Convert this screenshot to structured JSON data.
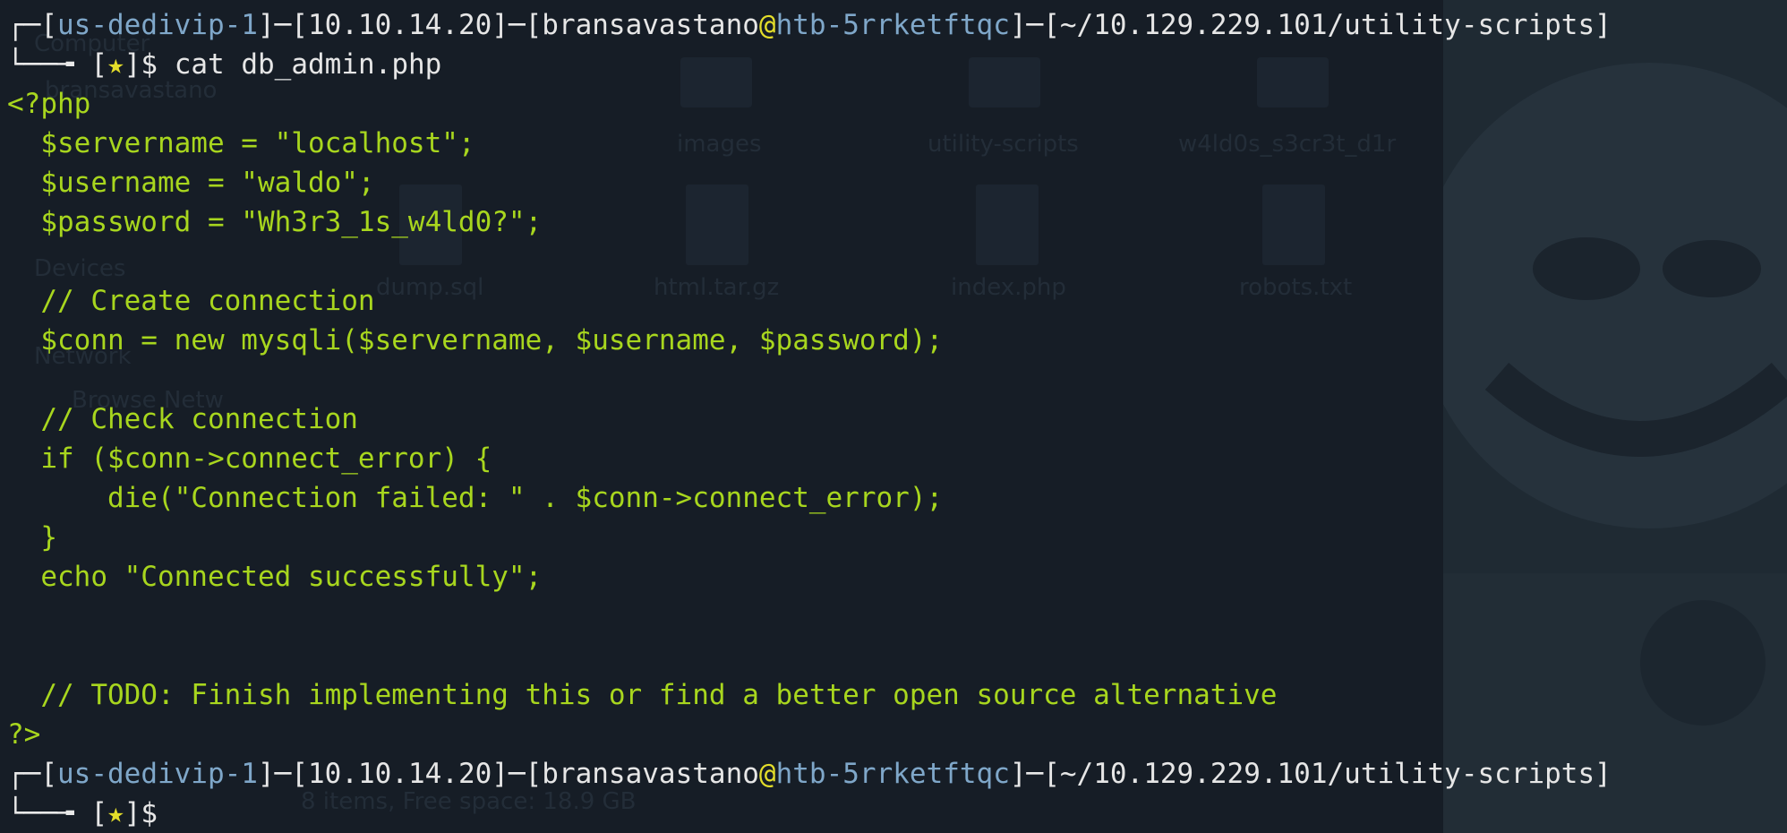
{
  "desktop": {
    "sidebar_items": [
      "Computer",
      "bransavastano",
      "Devices",
      "Network",
      "Browse Netw"
    ],
    "folders": [
      "images",
      "utility-scripts",
      "w4ld0s_s3cr3t_d1r"
    ],
    "files": [
      "dump.sql",
      "html.tar.gz",
      "index.php",
      "robots.txt"
    ],
    "status": "8 items, Free space: 18.9 GB"
  },
  "prompt": {
    "frame_top": "┌─",
    "frame_bottom": "└──╼",
    "host_label": "us-dedivip-1",
    "ip": "10.10.14.20",
    "user": "bransavastano",
    "machine": "htb-5rrketftqc",
    "path": "~/10.129.229.101/utility-scripts",
    "star": "★",
    "sep": "]─[",
    "open": "[",
    "close": "]",
    "dollar": "$"
  },
  "command": "cat db_admin.php",
  "code_lines": [
    "<?php",
    "  $servername = \"localhost\";",
    "  $username = \"waldo\";",
    "  $password = \"Wh3r3_1s_w4ld0?\";",
    "",
    "  // Create connection",
    "  $conn = new mysqli($servername, $username, $password);",
    "",
    "  // Check connection",
    "  if ($conn->connect_error) {",
    "      die(\"Connection failed: \" . $conn->connect_error);",
    "  }",
    "  echo \"Connected successfully\";",
    "",
    "",
    "  // TODO: Finish implementing this or find a better open source alternative",
    "?>"
  ],
  "colors": {
    "background": "#161d26",
    "text_green": "#a8d61e",
    "prompt_blue": "#7fa7c9",
    "star_yellow": "#e3dd2a",
    "white": "#e6e6e6"
  }
}
